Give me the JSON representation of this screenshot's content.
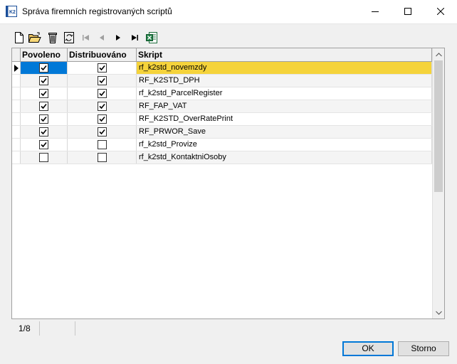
{
  "window": {
    "title": "Správa firemních registrovaných scriptů",
    "icon": "k2-app-icon",
    "controls": [
      "minimize-icon",
      "maximize-icon",
      "close-icon"
    ]
  },
  "toolbar": {
    "buttons": [
      "new-icon",
      "open-icon",
      "delete-icon",
      "refresh-icon",
      "first-record-icon",
      "prior-record-icon",
      "next-record-icon",
      "last-record-icon",
      "excel-export-icon"
    ]
  },
  "grid": {
    "columns": [
      "Povoleno",
      "Distribuováno",
      "Skript"
    ],
    "rows": [
      {
        "povoleno": true,
        "distribuovano": true,
        "skript": "rf_k2std_novemzdy",
        "selected": true
      },
      {
        "povoleno": true,
        "distribuovano": true,
        "skript": "RF_K2STD_DPH",
        "selected": false
      },
      {
        "povoleno": true,
        "distribuovano": true,
        "skript": "rf_k2std_ParcelRegister",
        "selected": false
      },
      {
        "povoleno": true,
        "distribuovano": true,
        "skript": "RF_FAP_VAT",
        "selected": false
      },
      {
        "povoleno": true,
        "distribuovano": true,
        "skript": "RF_K2STD_OverRatePrint",
        "selected": false
      },
      {
        "povoleno": true,
        "distribuovano": true,
        "skript": "RF_PRWOR_Save",
        "selected": false
      },
      {
        "povoleno": true,
        "distribuovano": false,
        "skript": "rf_k2std_Provize",
        "selected": false
      },
      {
        "povoleno": false,
        "distribuovano": false,
        "skript": "rf_k2std_KontaktniOsoby",
        "selected": false
      }
    ],
    "selection_color": "#f5d33b"
  },
  "status": {
    "position": "1/8"
  },
  "buttons": {
    "ok": "OK",
    "cancel": "Storno"
  }
}
